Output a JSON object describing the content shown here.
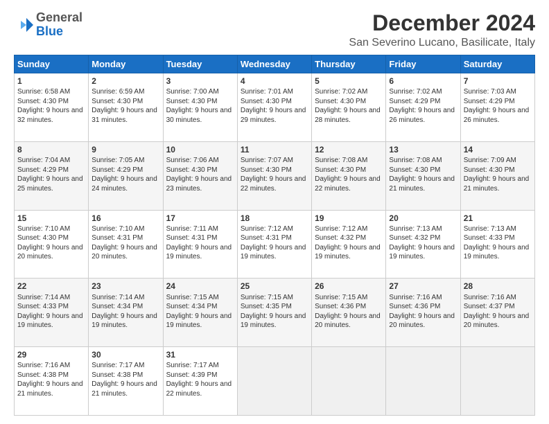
{
  "logo": {
    "general": "General",
    "blue": "Blue"
  },
  "header": {
    "month": "December 2024",
    "location": "San Severino Lucano, Basilicate, Italy"
  },
  "days": [
    "Sunday",
    "Monday",
    "Tuesday",
    "Wednesday",
    "Thursday",
    "Friday",
    "Saturday"
  ],
  "weeks": [
    [
      {
        "day": 1,
        "sunrise": "6:58 AM",
        "sunset": "4:30 PM",
        "daylight": "9 hours and 32 minutes."
      },
      {
        "day": 2,
        "sunrise": "6:59 AM",
        "sunset": "4:30 PM",
        "daylight": "9 hours and 31 minutes."
      },
      {
        "day": 3,
        "sunrise": "7:00 AM",
        "sunset": "4:30 PM",
        "daylight": "9 hours and 30 minutes."
      },
      {
        "day": 4,
        "sunrise": "7:01 AM",
        "sunset": "4:30 PM",
        "daylight": "9 hours and 29 minutes."
      },
      {
        "day": 5,
        "sunrise": "7:02 AM",
        "sunset": "4:30 PM",
        "daylight": "9 hours and 28 minutes."
      },
      {
        "day": 6,
        "sunrise": "7:02 AM",
        "sunset": "4:29 PM",
        "daylight": "9 hours and 26 minutes."
      },
      {
        "day": 7,
        "sunrise": "7:03 AM",
        "sunset": "4:29 PM",
        "daylight": "9 hours and 26 minutes."
      }
    ],
    [
      {
        "day": 8,
        "sunrise": "7:04 AM",
        "sunset": "4:29 PM",
        "daylight": "9 hours and 25 minutes."
      },
      {
        "day": 9,
        "sunrise": "7:05 AM",
        "sunset": "4:29 PM",
        "daylight": "9 hours and 24 minutes."
      },
      {
        "day": 10,
        "sunrise": "7:06 AM",
        "sunset": "4:30 PM",
        "daylight": "9 hours and 23 minutes."
      },
      {
        "day": 11,
        "sunrise": "7:07 AM",
        "sunset": "4:30 PM",
        "daylight": "9 hours and 22 minutes."
      },
      {
        "day": 12,
        "sunrise": "7:08 AM",
        "sunset": "4:30 PM",
        "daylight": "9 hours and 22 minutes."
      },
      {
        "day": 13,
        "sunrise": "7:08 AM",
        "sunset": "4:30 PM",
        "daylight": "9 hours and 21 minutes."
      },
      {
        "day": 14,
        "sunrise": "7:09 AM",
        "sunset": "4:30 PM",
        "daylight": "9 hours and 21 minutes."
      }
    ],
    [
      {
        "day": 15,
        "sunrise": "7:10 AM",
        "sunset": "4:30 PM",
        "daylight": "9 hours and 20 minutes."
      },
      {
        "day": 16,
        "sunrise": "7:10 AM",
        "sunset": "4:31 PM",
        "daylight": "9 hours and 20 minutes."
      },
      {
        "day": 17,
        "sunrise": "7:11 AM",
        "sunset": "4:31 PM",
        "daylight": "9 hours and 19 minutes."
      },
      {
        "day": 18,
        "sunrise": "7:12 AM",
        "sunset": "4:31 PM",
        "daylight": "9 hours and 19 minutes."
      },
      {
        "day": 19,
        "sunrise": "7:12 AM",
        "sunset": "4:32 PM",
        "daylight": "9 hours and 19 minutes."
      },
      {
        "day": 20,
        "sunrise": "7:13 AM",
        "sunset": "4:32 PM",
        "daylight": "9 hours and 19 minutes."
      },
      {
        "day": 21,
        "sunrise": "7:13 AM",
        "sunset": "4:33 PM",
        "daylight": "9 hours and 19 minutes."
      }
    ],
    [
      {
        "day": 22,
        "sunrise": "7:14 AM",
        "sunset": "4:33 PM",
        "daylight": "9 hours and 19 minutes."
      },
      {
        "day": 23,
        "sunrise": "7:14 AM",
        "sunset": "4:34 PM",
        "daylight": "9 hours and 19 minutes."
      },
      {
        "day": 24,
        "sunrise": "7:15 AM",
        "sunset": "4:34 PM",
        "daylight": "9 hours and 19 minutes."
      },
      {
        "day": 25,
        "sunrise": "7:15 AM",
        "sunset": "4:35 PM",
        "daylight": "9 hours and 19 minutes."
      },
      {
        "day": 26,
        "sunrise": "7:15 AM",
        "sunset": "4:36 PM",
        "daylight": "9 hours and 20 minutes."
      },
      {
        "day": 27,
        "sunrise": "7:16 AM",
        "sunset": "4:36 PM",
        "daylight": "9 hours and 20 minutes."
      },
      {
        "day": 28,
        "sunrise": "7:16 AM",
        "sunset": "4:37 PM",
        "daylight": "9 hours and 20 minutes."
      }
    ],
    [
      {
        "day": 29,
        "sunrise": "7:16 AM",
        "sunset": "4:38 PM",
        "daylight": "9 hours and 21 minutes."
      },
      {
        "day": 30,
        "sunrise": "7:17 AM",
        "sunset": "4:38 PM",
        "daylight": "9 hours and 21 minutes."
      },
      {
        "day": 31,
        "sunrise": "7:17 AM",
        "sunset": "4:39 PM",
        "daylight": "9 hours and 22 minutes."
      },
      null,
      null,
      null,
      null
    ]
  ]
}
